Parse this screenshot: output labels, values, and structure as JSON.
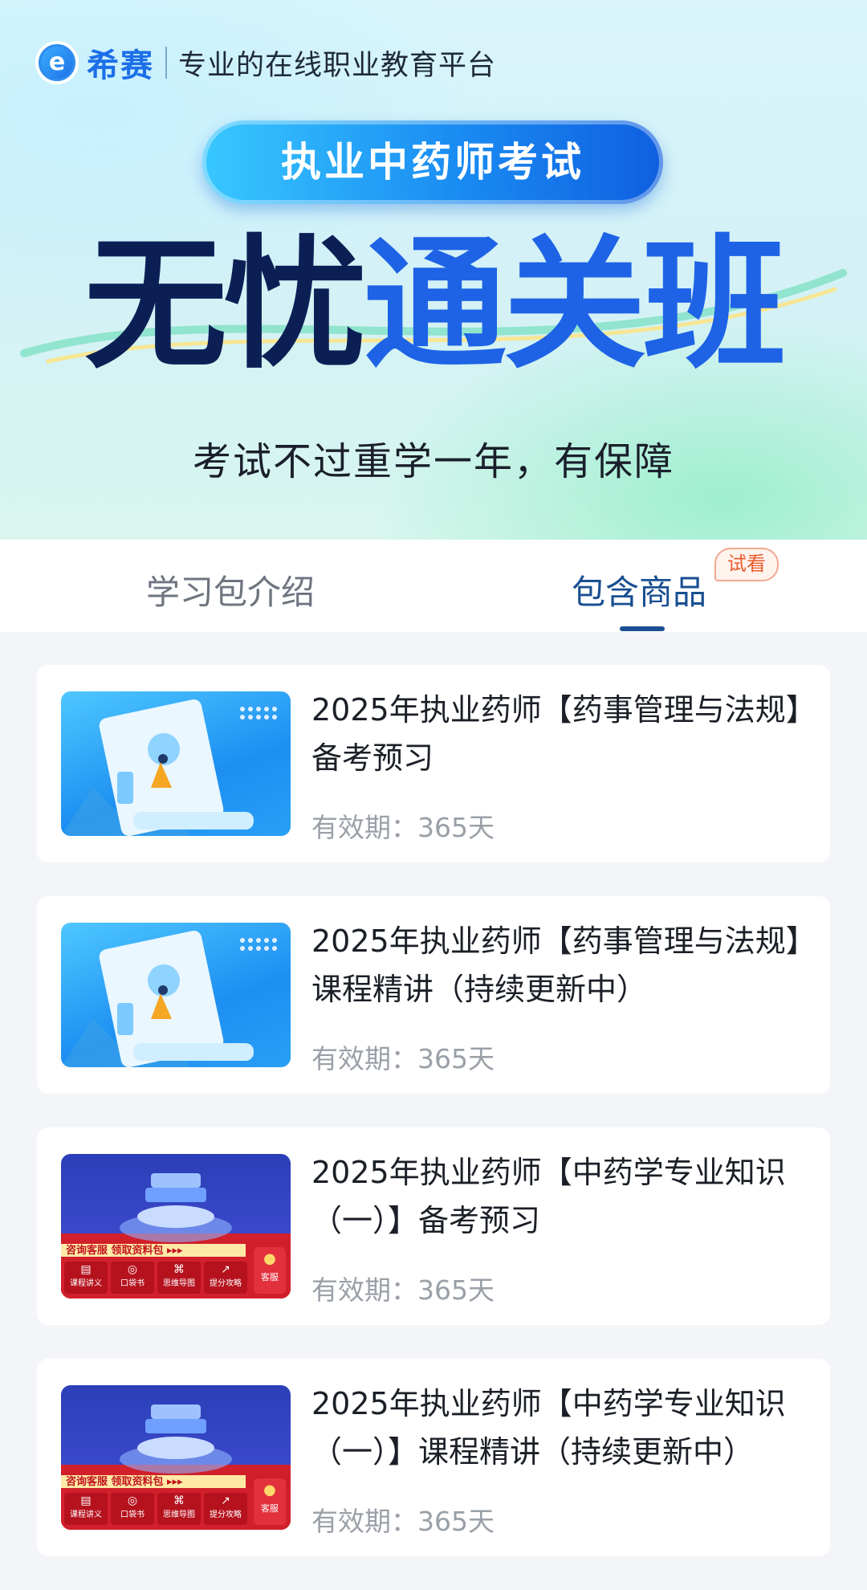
{
  "brand": {
    "logo_mark": "e",
    "name": "希赛",
    "slogan": "专业的在线职业教育平台"
  },
  "banner": {
    "exam_label": "执业中药师考试",
    "headline_dark": "无忧",
    "headline_blue": "通关班",
    "subtitle": "考试不过重学一年，有保障"
  },
  "tabs": {
    "intro_label": "学习包介绍",
    "goods_label": "包含商品",
    "trial_badge": "试看",
    "active": "goods"
  },
  "products": [
    {
      "title": "2025年执业药师【药事管理与法规】备考预习",
      "validity": "有效期：365天",
      "thumb": "blue-scroll"
    },
    {
      "title": "2025年执业药师【药事管理与法规】课程精讲（持续更新中）",
      "validity": "有效期：365天",
      "thumb": "blue-scroll"
    },
    {
      "title": "2025年执业药师【中药学专业知识（一）】备考预习",
      "validity": "有效期：365天",
      "thumb": "red-books"
    },
    {
      "title": "2025年执业药师【中药学专业知识（一）】课程精讲（持续更新中）",
      "validity": "有效期：365天",
      "thumb": "red-books"
    }
  ],
  "red_thumb": {
    "promo": "咨询客服  领取资料包 ▸▸▸",
    "items": [
      "课程讲义",
      "口袋书",
      "思维导图",
      "提分攻略"
    ],
    "service": "客服"
  },
  "colors": {
    "brand_blue": "#1c6fe8",
    "headline_dark": "#0c1f55",
    "headline_blue": "#1e63e6",
    "tab_active": "#1a4f91",
    "badge_orange": "#ea5b2c"
  }
}
